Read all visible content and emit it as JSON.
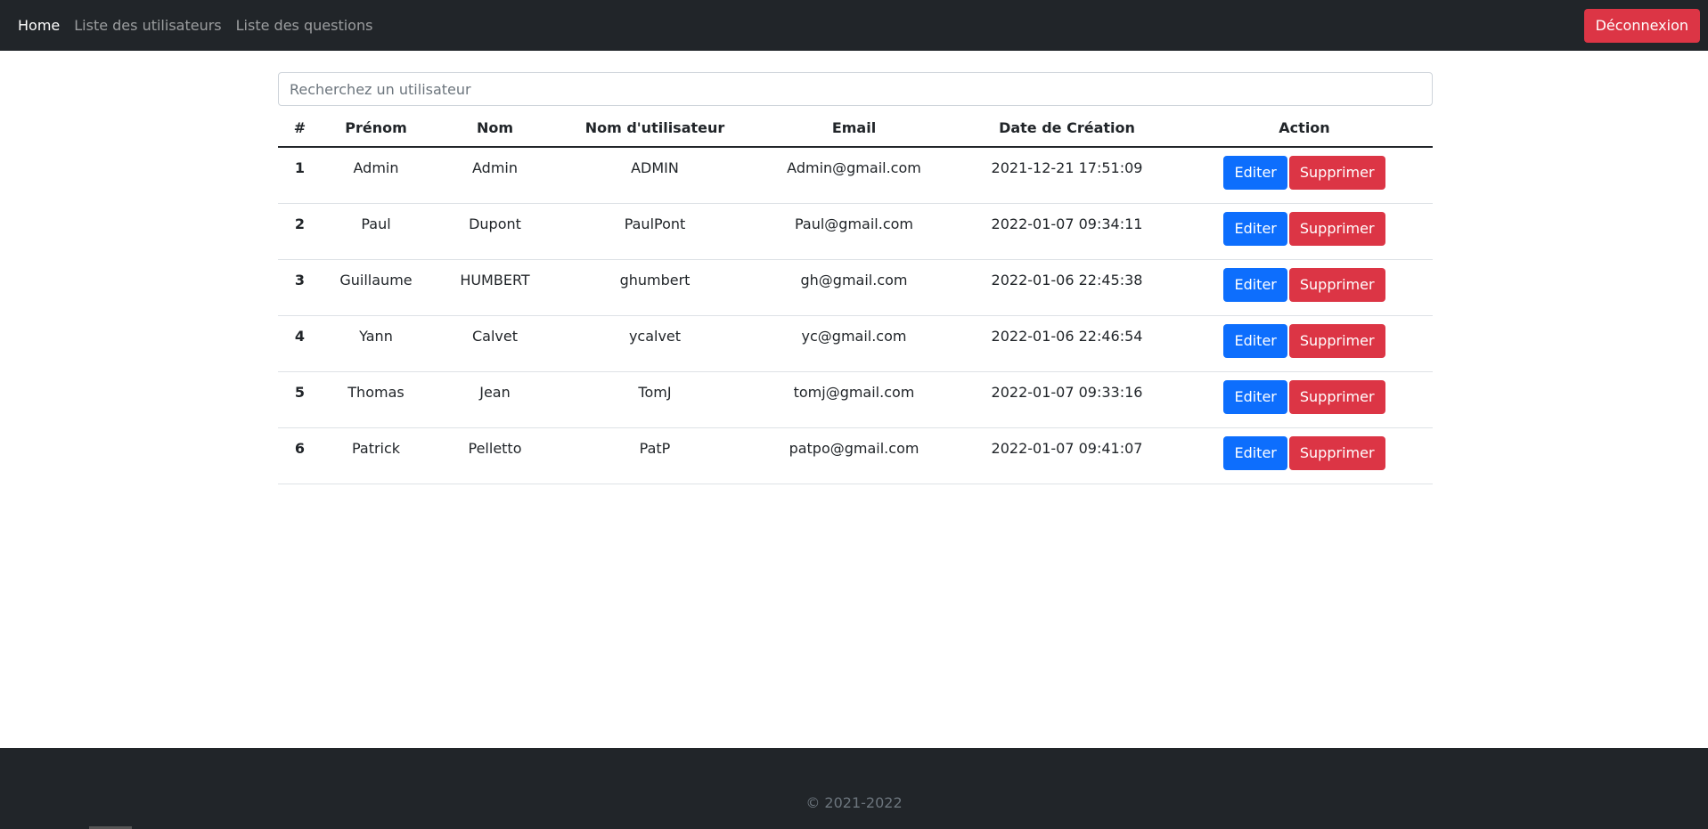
{
  "nav": {
    "items": [
      {
        "label": "Home",
        "active": true
      },
      {
        "label": "Liste des utilisateurs",
        "active": false
      },
      {
        "label": "Liste des questions",
        "active": false
      }
    ],
    "logout_label": "Déconnexion"
  },
  "search": {
    "placeholder": "Recherchez un utilisateur",
    "value": ""
  },
  "table": {
    "headers": [
      "#",
      "Prénom",
      "Nom",
      "Nom d'utilisateur",
      "Email",
      "Date de Création",
      "Action"
    ],
    "rows": [
      {
        "id": "1",
        "prenom": "Admin",
        "nom": "Admin",
        "username": "ADMIN",
        "email": "Admin@gmail.com",
        "date": "2021-12-21 17:51:09"
      },
      {
        "id": "2",
        "prenom": "Paul",
        "nom": "Dupont",
        "username": "PaulPont",
        "email": "Paul@gmail.com",
        "date": "2022-01-07 09:34:11"
      },
      {
        "id": "3",
        "prenom": "Guillaume",
        "nom": "HUMBERT",
        "username": "ghumbert",
        "email": "gh@gmail.com",
        "date": "2022-01-06 22:45:38"
      },
      {
        "id": "4",
        "prenom": "Yann",
        "nom": "Calvet",
        "username": "ycalvet",
        "email": "yc@gmail.com",
        "date": "2022-01-06 22:46:54"
      },
      {
        "id": "5",
        "prenom": "Thomas",
        "nom": "Jean",
        "username": "TomJ",
        "email": "tomj@gmail.com",
        "date": "2022-01-07 09:33:16"
      },
      {
        "id": "6",
        "prenom": "Patrick",
        "nom": "Pelletto",
        "username": "PatP",
        "email": "patpo@gmail.com",
        "date": "2022-01-07 09:41:07"
      }
    ],
    "edit_label": "Editer",
    "delete_label": "Supprimer"
  },
  "footer": {
    "text": "© 2021-2022"
  },
  "colors": {
    "navbar": "#212529",
    "primary": "#0d6efd",
    "danger": "#dc3545"
  }
}
